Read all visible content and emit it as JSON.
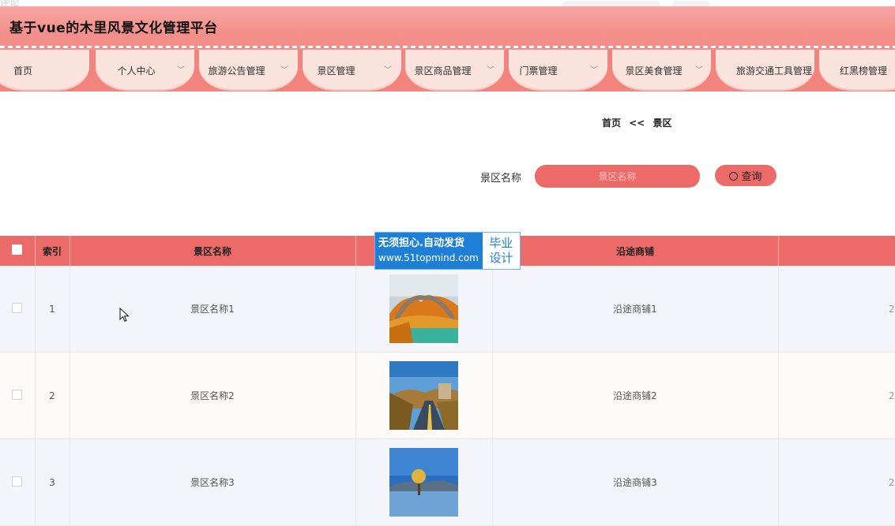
{
  "header": {
    "ghost_text": "评论",
    "title": "基于vue的木里风景文化管理平台"
  },
  "nav": {
    "items": [
      {
        "label": "首页",
        "has_dropdown": false
      },
      {
        "label": "个人中心",
        "has_dropdown": true
      },
      {
        "label": "旅游公告管理",
        "has_dropdown": true
      },
      {
        "label": "景区管理",
        "has_dropdown": true
      },
      {
        "label": "景区商品管理",
        "has_dropdown": true
      },
      {
        "label": "门票管理",
        "has_dropdown": true
      },
      {
        "label": "景区美食管理",
        "has_dropdown": true
      },
      {
        "label": "旅游交通工具管理",
        "has_dropdown": false
      },
      {
        "label": "红黑榜管理",
        "has_dropdown": false
      }
    ]
  },
  "breadcrumb": {
    "home": "首页",
    "sep": "<<",
    "current": "景区"
  },
  "search": {
    "label": "景区名称",
    "placeholder": "景区名称",
    "button": "查询"
  },
  "table": {
    "headers": [
      "索引",
      "景区名称",
      "",
      "沿途商铺",
      ""
    ],
    "rows": [
      {
        "index": "1",
        "name": "景区名称1",
        "shops": "沿途商铺1",
        "trailing": "2"
      },
      {
        "index": "2",
        "name": "景区名称2",
        "shops": "沿途商铺2",
        "trailing": "2"
      },
      {
        "index": "3",
        "name": "景区名称3",
        "shops": "沿途商铺3",
        "trailing": "2"
      }
    ]
  },
  "watermark": {
    "line1": "无须担心.自动发货",
    "line2": "www.51topmind.com",
    "right1": "毕业",
    "right2": "设计"
  },
  "colors": {
    "accent": "#ec6b69",
    "title_bar": "#f38f8a",
    "nav_pill": "#fbe3dd"
  }
}
